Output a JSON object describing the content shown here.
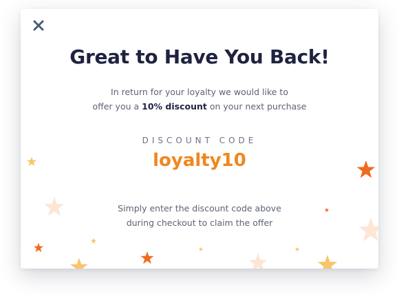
{
  "modal": {
    "close_icon": "close-icon",
    "title": "Great to Have You Back!",
    "intro": {
      "line1": "In return for your loyalty we would like to",
      "line2_prefix": "offer you a ",
      "line2_bold": "10% discount",
      "line2_suffix": " on your next purchase"
    },
    "discount": {
      "label": "DISCOUNT CODE",
      "code": "loyalty10"
    },
    "instructions": {
      "line1": "Simply enter the discount code above",
      "line2": "during checkout to claim the offer"
    },
    "decoration_icon": "star-icon"
  },
  "colors": {
    "title": "#1f2340",
    "body_text": "#5e6275",
    "code": "#f0871e",
    "close": "#4b5a78",
    "star_orange_dark": "#f06a1e",
    "star_orange": "#f0871e",
    "star_gold": "#f9c46a",
    "star_pale": "#fde6d6"
  }
}
